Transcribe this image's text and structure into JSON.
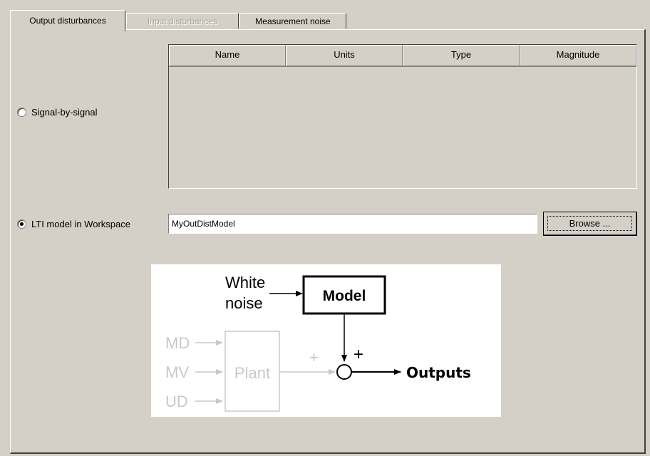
{
  "tabs": [
    {
      "label": "Output disturbances",
      "state": "active"
    },
    {
      "label": "Input disturbances",
      "state": "disabled"
    },
    {
      "label": "Measurement noise",
      "state": "normal"
    }
  ],
  "signal_option": {
    "label": "Signal-by-signal",
    "selected": false
  },
  "table": {
    "columns": [
      "Name",
      "Units",
      "Type",
      "Magnitude"
    ],
    "rows": []
  },
  "lti_option": {
    "label": "LTI model in Workspace",
    "selected": true
  },
  "model_field": {
    "value": "MyOutDistModel"
  },
  "browse_button": {
    "label": "Browse ..."
  },
  "diagram": {
    "white_noise_line1": "White",
    "white_noise_line2": "noise",
    "model_label": "Model",
    "md_label": "MD",
    "mv_label": "MV",
    "ud_label": "UD",
    "plant_label": "Plant",
    "plus_left": "+",
    "plus_top": "+",
    "outputs_label": "Outputs",
    "active_color": "#000000",
    "inactive_color": "#c8c8c8"
  }
}
